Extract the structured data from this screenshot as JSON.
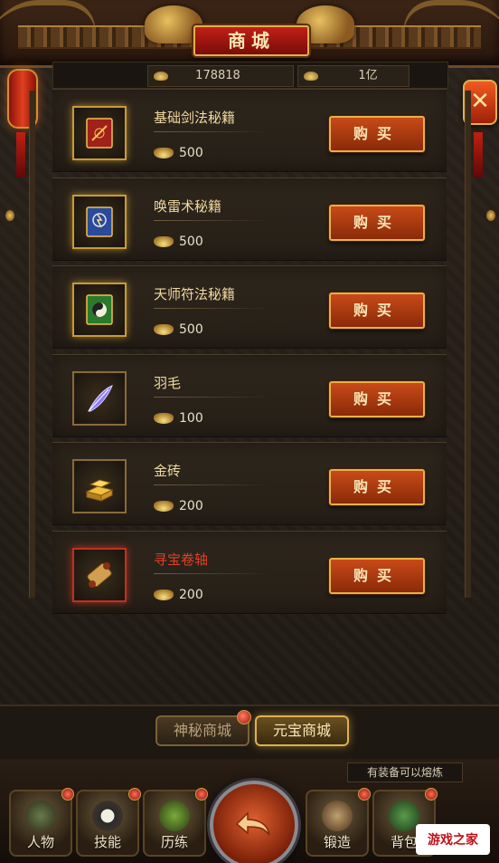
{
  "header": {
    "title": "商城"
  },
  "currency": {
    "silver": "178818",
    "gold": "1亿"
  },
  "items": [
    {
      "name": "基础剑法秘籍",
      "price": "500",
      "highlight": "gold",
      "icon": "sword-book-icon",
      "name_color": "normal"
    },
    {
      "name": "唤雷术秘籍",
      "price": "500",
      "highlight": "gold",
      "icon": "thunder-book-icon",
      "name_color": "normal"
    },
    {
      "name": "天师符法秘籍",
      "price": "500",
      "highlight": "gold",
      "icon": "talisman-book-icon",
      "name_color": "normal"
    },
    {
      "name": "羽毛",
      "price": "100",
      "highlight": "brown",
      "icon": "feather-icon",
      "name_color": "normal"
    },
    {
      "name": "金砖",
      "price": "200",
      "highlight": "brown",
      "icon": "gold-brick-icon",
      "name_color": "normal"
    },
    {
      "name": "寻宝卷轴",
      "price": "200",
      "highlight": "red",
      "icon": "treasure-scroll-icon",
      "name_color": "red"
    }
  ],
  "buy_label": "购买",
  "tabs": {
    "mystic": "神秘商城",
    "yuanbao": "元宝商城"
  },
  "hint": "有装备可以熔炼",
  "nav": {
    "character": "人物",
    "skills": "技能",
    "training": "历练",
    "forge": "锻造",
    "bag": "背包"
  },
  "watermark": "游戏之家"
}
